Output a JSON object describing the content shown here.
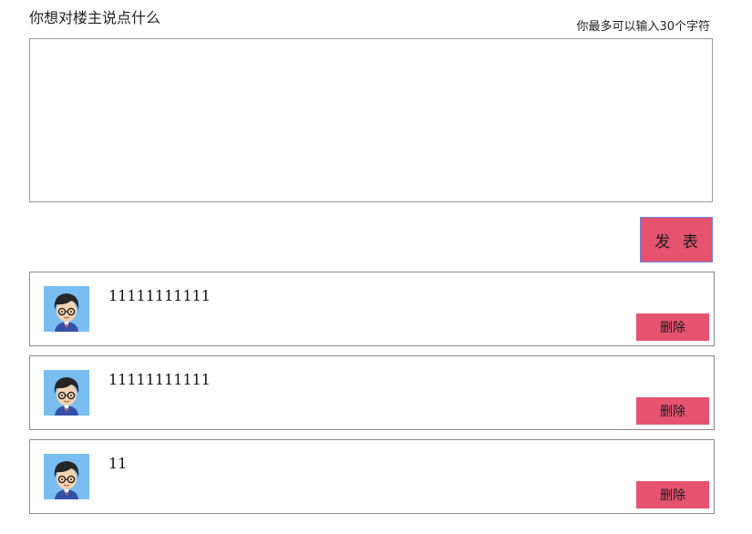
{
  "form": {
    "title": "你想对楼主说点什么",
    "char_limit_hint": "你最多可以输入30个字符",
    "textarea_value": "",
    "submit_label": "发 表"
  },
  "colors": {
    "button_bg": "#e5536f",
    "avatar_bg": "#79bdf1",
    "border": "#8a8a8a"
  },
  "comments": [
    {
      "avatar_icon": "boy-with-glasses-avatar",
      "text": "11111111111",
      "delete_label": "删除"
    },
    {
      "avatar_icon": "boy-with-glasses-avatar",
      "text": "11111111111",
      "delete_label": "删除"
    },
    {
      "avatar_icon": "boy-with-glasses-avatar",
      "text": "11",
      "delete_label": "删除"
    }
  ]
}
